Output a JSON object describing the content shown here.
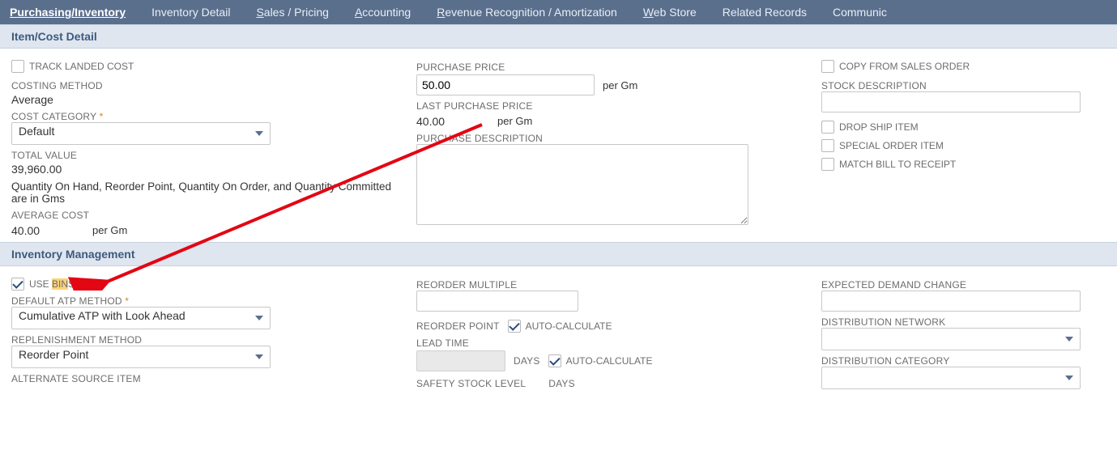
{
  "tabs": {
    "purchasing_inventory": "Purchasing/Inventory",
    "inventory_detail": "Inventory Detail",
    "sales_pricing": "Sales / Pricing",
    "accounting": "Accounting",
    "revenue_recognition": "Revenue Recognition / Amortization",
    "web_store": "Web Store",
    "related_records": "Related Records",
    "communication": "Communic"
  },
  "sections": {
    "item_cost_detail": "Item/Cost Detail",
    "inventory_management": "Inventory Management"
  },
  "item_cost": {
    "track_landed_cost_label": "Track Landed Cost",
    "costing_method_label": "COSTING METHOD",
    "costing_method_value": "Average",
    "cost_category_label": "COST CATEGORY",
    "cost_category_value": "Default",
    "total_value_label": "TOTAL VALUE",
    "total_value_value": "39,960.00",
    "qty_note": "Quantity On Hand, Reorder Point, Quantity On Order, and Quantity Committed are in Gms",
    "average_cost_label": "AVERAGE COST",
    "average_cost_value": "40.00",
    "average_cost_unit": "per Gm",
    "purchase_price_label": "PURCHASE PRICE",
    "purchase_price_value": "50.00",
    "purchase_price_unit": "per Gm",
    "last_purchase_price_label": "LAST PURCHASE PRICE",
    "last_purchase_price_value": "40.00",
    "last_purchase_price_unit": "per Gm",
    "purchase_description_label": "PURCHASE DESCRIPTION",
    "purchase_description_value": "",
    "copy_from_sales_order_label": "Copy From Sales Order",
    "stock_description_label": "STOCK DESCRIPTION",
    "stock_description_value": "",
    "drop_ship_item_label": "Drop Ship Item",
    "special_order_item_label": "Special Order Item",
    "match_bill_to_receipt_label": "Match Bill To Receipt"
  },
  "inv_mgmt": {
    "use_bins_prefix": "Use ",
    "use_bins_hl": "Bin",
    "use_bins_suffix": "s",
    "default_atp_method_label": "DEFAULT ATP METHOD",
    "default_atp_method_value": "Cumulative ATP with Look Ahead",
    "replenishment_method_label": "REPLENISHMENT METHOD",
    "replenishment_method_value": "Reorder Point",
    "alternate_source_item_label": "ALTERNATE SOURCE ITEM",
    "reorder_multiple_label": "REORDER MULTIPLE",
    "reorder_multiple_value": "",
    "reorder_point_label": "REORDER POINT",
    "auto_calculate_label": "Auto-Calculate",
    "lead_time_label": "LEAD TIME",
    "lead_time_value": "",
    "lead_time_unit": "DAYS",
    "safety_stock_level_label": "SAFETY STOCK LEVEL",
    "safety_stock_days_label": "DAYS",
    "expected_demand_change_label": "EXPECTED DEMAND CHANGE",
    "expected_demand_change_value": "",
    "distribution_network_label": "DISTRIBUTION NETWORK",
    "distribution_network_value": "",
    "distribution_category_label": "DISTRIBUTION CATEGORY",
    "distribution_category_value": ""
  }
}
